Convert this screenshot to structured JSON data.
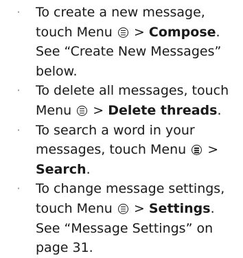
{
  "bullet_glyph": "·",
  "menu_icon": "menu-icon",
  "items": [
    {
      "pre": "To create a new message, touch Menu",
      "gt": ">",
      "target": "Compose",
      "post": ". See “Create New Messages” below."
    },
    {
      "pre": "To delete all messages, touch Menu",
      "gt": ">",
      "target": "Delete threads",
      "post": "."
    },
    {
      "pre": "To search a word in your messages, touch Menu",
      "gt": ">",
      "target": "Search",
      "post": "."
    },
    {
      "pre": "To change message settings, touch Menu",
      "gt": ">",
      "target": "Settings",
      "post": ". See “Message Settings” on page 31."
    }
  ]
}
